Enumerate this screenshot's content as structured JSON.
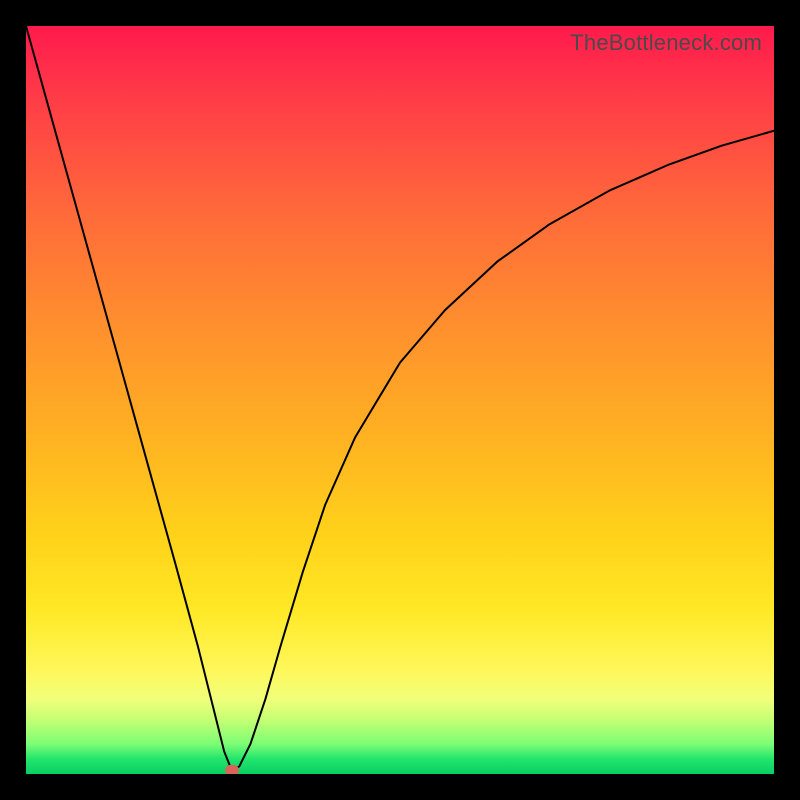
{
  "watermark": "TheBottleneck.com",
  "chart_data": {
    "type": "line",
    "title": "",
    "xlabel": "",
    "ylabel": "",
    "xlim": [
      0,
      100
    ],
    "ylim": [
      0,
      100
    ],
    "grid": false,
    "series": [
      {
        "name": "curve",
        "x": [
          0,
          5,
          10,
          15,
          20,
          23,
          25,
          26.5,
          27.5,
          28.5,
          30,
          32,
          34,
          37,
          40,
          44,
          50,
          56,
          63,
          70,
          78,
          86,
          93,
          100
        ],
        "values": [
          100,
          82,
          64,
          46,
          28,
          17,
          9,
          3,
          0.5,
          1,
          4,
          10,
          17,
          27,
          36,
          45,
          55,
          62,
          68.5,
          73.5,
          78,
          81.5,
          84,
          86
        ]
      }
    ],
    "marker": {
      "x": 27.5,
      "y": 0.5,
      "color": "#d9645a"
    }
  },
  "colors": {
    "frame": "#000000",
    "curve": "#000000",
    "watermark": "#4a4a4a"
  }
}
